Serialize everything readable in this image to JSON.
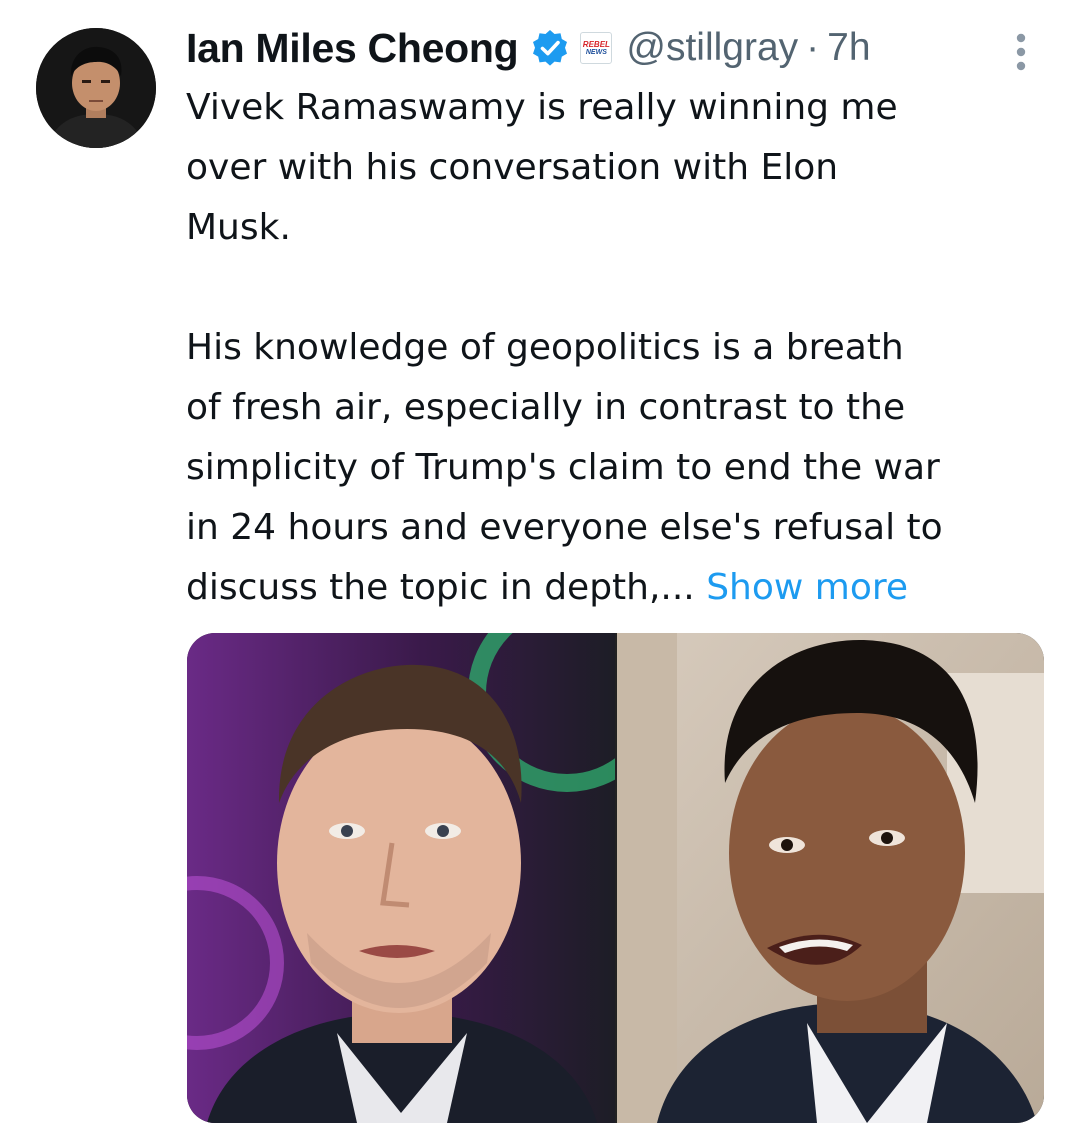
{
  "author": {
    "name": "Ian Miles Cheong",
    "handle": "@stillgray",
    "separator": "·",
    "time": "7h",
    "affiliate_badge": [
      "REBEL",
      "NEWS"
    ]
  },
  "tweet": {
    "paragraph1": [
      "Vivek Ramaswamy is really winning me",
      "over with his conversation with Elon",
      "Musk."
    ],
    "paragraph2": [
      "His knowledge of geopolitics is a breath",
      "of fresh air, especially in contrast to the",
      "simplicity of Trump's claim to end the war",
      "in 24 hours and everyone else's refusal to"
    ],
    "last_line": "discuss the topic in depth,...",
    "show_more": "Show more"
  },
  "colors": {
    "link": "#1d9bf0",
    "verified": "#1d9bf0",
    "secondary_text": "#536471",
    "primary_text": "#0f1419"
  },
  "icons": {
    "verified": "verified-badge-icon",
    "more": "more-options-icon"
  }
}
